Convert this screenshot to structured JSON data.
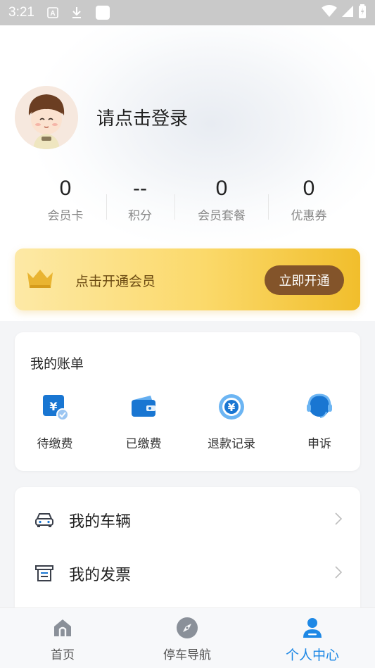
{
  "status_bar": {
    "time": "3:21"
  },
  "profile": {
    "login_prompt": "请点击登录"
  },
  "stats": [
    {
      "value": "0",
      "label": "会员卡"
    },
    {
      "value": "--",
      "label": "积分"
    },
    {
      "value": "0",
      "label": "会员套餐"
    },
    {
      "value": "0",
      "label": "优惠券"
    }
  ],
  "member_banner": {
    "text": "点击开通会员",
    "button": "立即开通"
  },
  "bills": {
    "title": "我的账单",
    "items": [
      {
        "label": "待缴费",
        "icon": "pending-payment-icon"
      },
      {
        "label": "已缴费",
        "icon": "wallet-icon"
      },
      {
        "label": "退款记录",
        "icon": "refund-icon"
      },
      {
        "label": "申诉",
        "icon": "customer-service-icon"
      }
    ]
  },
  "menu": [
    {
      "label": "我的车辆",
      "icon": "car-icon"
    },
    {
      "label": "我的发票",
      "icon": "invoice-icon"
    }
  ],
  "tabs": [
    {
      "label": "首页",
      "icon": "home-icon"
    },
    {
      "label": "停车导航",
      "icon": "compass-icon"
    },
    {
      "label": "个人中心",
      "icon": "user-icon",
      "active": true
    }
  ],
  "colors": {
    "accent": "#1e88e5",
    "gold_button": "#83542a",
    "icon_blue": "#1976d2"
  }
}
